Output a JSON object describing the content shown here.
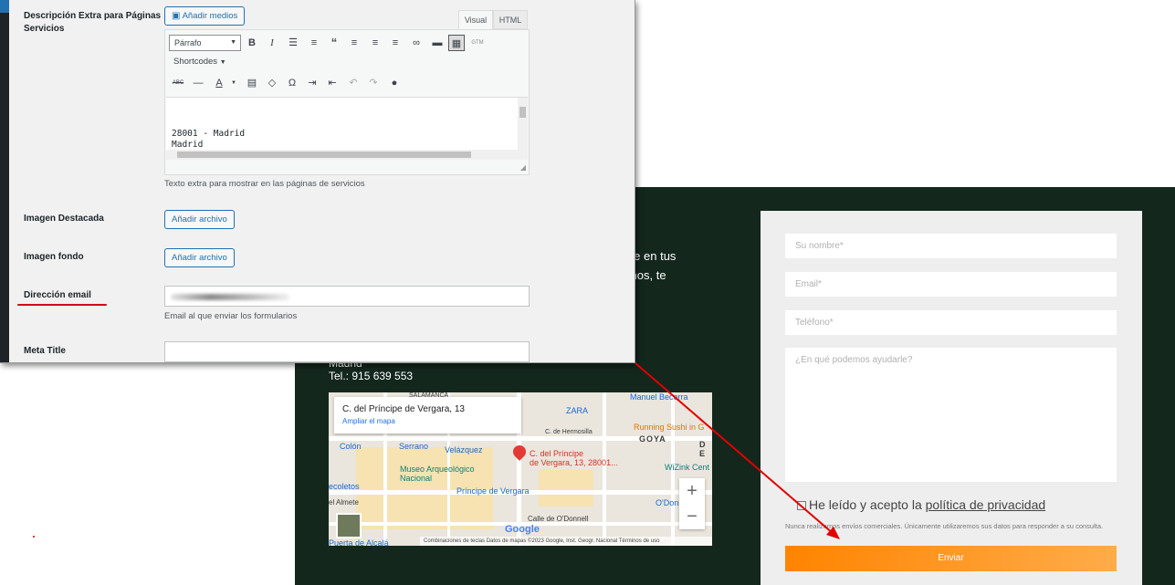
{
  "admin": {
    "fields": {
      "extra_desc_label_1": "Descripción Extra para Páginas",
      "extra_desc_label_2": "Servicios",
      "add_media": "Añadir medios",
      "tab_visual": "Visual",
      "tab_html": "HTML",
      "format_select": "Párrafo",
      "shortcodes": "Shortcodes",
      "editor_lines": [
        "28001 - Madrid",
        "Madrid"
      ],
      "extra_help": "Texto extra para mostrar en las páginas de servicios",
      "featured_label": "Imagen Destacada",
      "featured_button": "Añadir archivo",
      "bg_label": "Imagen fondo",
      "bg_button": "Añadir archivo",
      "email_label": "Dirección email",
      "email_help": "Email al que enviar los formularios",
      "meta_title_label": "Meta Title"
    },
    "toolbar_icons_row1": [
      "bold-icon",
      "italic-icon",
      "bullet-list-icon",
      "numbered-list-icon",
      "blockquote-icon",
      "align-left-icon",
      "align-center-icon",
      "align-right-icon",
      "link-icon",
      "read-more-icon",
      "toolbar-toggle-icon",
      "gtm-icon"
    ],
    "toolbar_icons_row2": [
      "strikethrough-icon",
      "horizontal-line-icon",
      "text-color-icon",
      "paste-text-icon",
      "clear-formatting-icon",
      "special-character-icon",
      "indent-icon",
      "outdent-icon",
      "undo-icon",
      "redo-icon",
      "help-icon"
    ]
  },
  "site": {
    "partial_lines": [
      "erte en tus",
      "arnos, te",
      "e."
    ],
    "address_partial": "Madrid",
    "phone": "Tel.: 915 639 553",
    "map": {
      "card_title": "C. del Príncipe de Vergara, 13",
      "card_link": "Ampliar el mapa",
      "pin_label_1": "C. del Príncipe",
      "pin_label_2": "de Vergara, 13, 28001...",
      "labels": {
        "salamanca": "SALAMANCA",
        "manuel_becerra": "Manuel Becerra",
        "zara": "ZARA",
        "hermosilla": "C. de Hermosilla",
        "running_sushi": "Running Sushi in G",
        "goya": "GOYA",
        "colon": "Colón",
        "serrano": "Serrano",
        "velazquez": "Velázquez",
        "museo_1": "Museo Arqueológico",
        "museo_2": "Nacional",
        "wizink": "WiZink Cent",
        "recoletos": "ecoletos",
        "principe_vergara": "Príncipe de Vergara",
        "odonnell_metro": "O'Donnell",
        "almete": "el Almete",
        "calle_odonnell": "Calle de O'Donnell",
        "puerta_alcala": "Puerta de Alcalá",
        "d_label": "D",
        "e_label": "E"
      },
      "google": "Google",
      "footer": "Combinaciones de teclas    Datos de mapas ©2023 Google, Inst. Geogr. Nacional    Términos de uso"
    },
    "form": {
      "name_placeholder": "Su nombre*",
      "email_placeholder": "Email*",
      "phone_placeholder": "Teléfono*",
      "message_placeholder": "¿En qué podemos ayudarle?",
      "accept_text": "He leído y acepto la ",
      "privacy_link": "política de privacidad",
      "disclaimer": "Nunca realizamos envíos comerciales. Únicamente utilizaremos sus datos para responder a su consulta.",
      "submit": "Enviar"
    }
  },
  "colors": {
    "site_bg": "#13271d",
    "wp_accent": "#2271b1",
    "annotation_red": "#d0021b",
    "button_orange": "#ff8400"
  }
}
